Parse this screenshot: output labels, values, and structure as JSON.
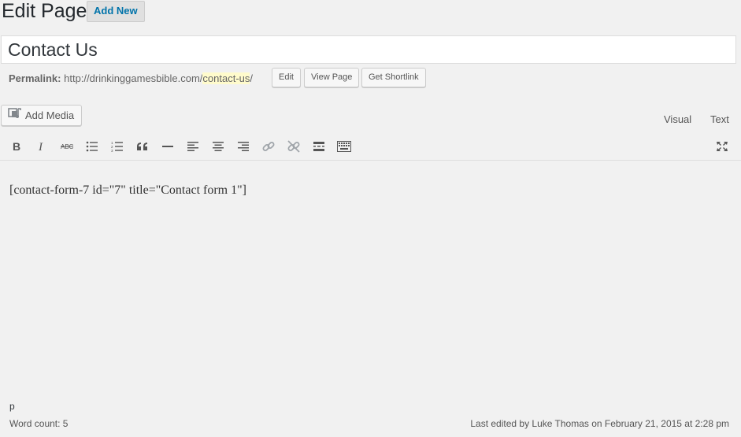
{
  "header": {
    "title": "Edit Page",
    "add_new_label": "Add New"
  },
  "post": {
    "title_value": "Contact Us"
  },
  "permalink": {
    "label": "Permalink:",
    "base_url": "http://drinkinggamesbible.com/",
    "slug": "contact-us",
    "trailing": "/",
    "edit_label": "Edit",
    "view_label": "View Page",
    "shortlink_label": "Get Shortlink"
  },
  "media": {
    "add_media_label": "Add Media"
  },
  "editor_tabs": {
    "visual": "Visual",
    "text": "Text"
  },
  "toolbar": {
    "icons": [
      "bold-icon",
      "italic-icon",
      "strikethrough-icon",
      "bulleted-list-icon",
      "numbered-list-icon",
      "blockquote-icon",
      "horizontal-line-icon",
      "align-left-icon",
      "align-center-icon",
      "align-right-icon",
      "link-icon",
      "unlink-icon",
      "read-more-icon",
      "toolbar-toggle-icon",
      "fullscreen-icon"
    ]
  },
  "editor": {
    "content": "[contact-form-7 id=\"7\" title=\"Contact form 1\"]"
  },
  "status": {
    "path": "p",
    "word_count": "Word count: 5",
    "last_edited": "Last edited by Luke Thomas on February 21, 2015 at 2:28 pm"
  }
}
